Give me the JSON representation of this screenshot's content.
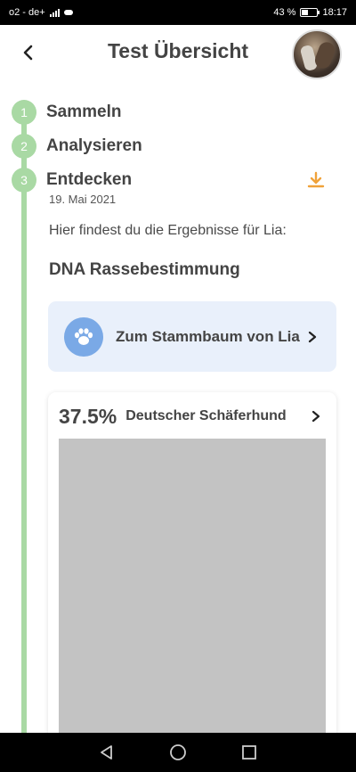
{
  "status_bar": {
    "carrier": "o2 - de+",
    "network": "4G",
    "battery_percent": "43 %",
    "battery_level": 0.43,
    "time": "18:17"
  },
  "header": {
    "title": "Test Übersicht",
    "back_icon": "chevron-left-icon"
  },
  "steps": [
    {
      "number": "1",
      "label": "Sammeln"
    },
    {
      "number": "2",
      "label": "Analysieren"
    },
    {
      "number": "3",
      "label": "Entdecken"
    }
  ],
  "content": {
    "date": "19. Mai 2021",
    "intro": "Hier findest du die Ergebnisse für Lia:",
    "section_title": "DNA Rassebestimmung",
    "family_tree_label": "Zum Stammbaum von Lia",
    "breed_percent": "37.5%",
    "breed_name": "Deutscher Schäferhund"
  },
  "colors": {
    "timeline": "#a9d9a4",
    "download": "#f0a23a",
    "tree_card_bg": "#e9f0fb",
    "paw_circle": "#7aa9e6"
  }
}
